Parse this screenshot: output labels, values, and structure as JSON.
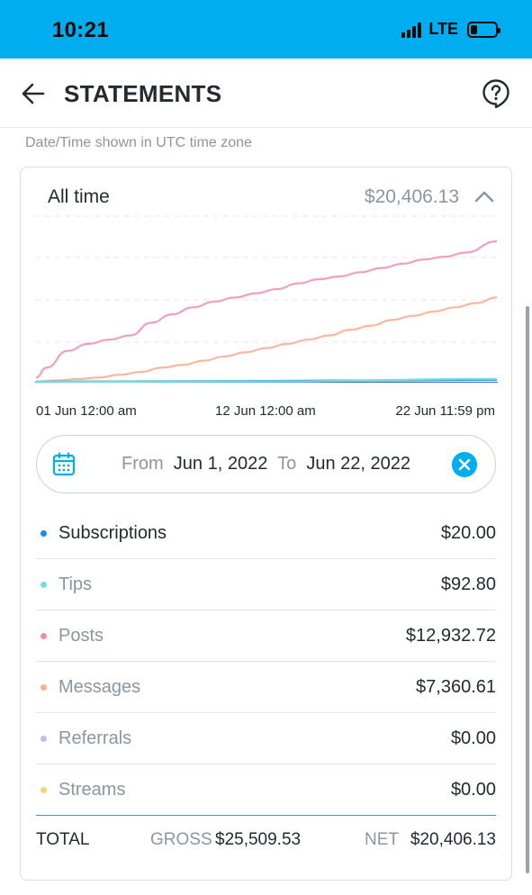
{
  "status_bar": {
    "time": "10:21",
    "network": "LTE",
    "battery_level": 0.25
  },
  "header": {
    "title": "STATEMENTS",
    "back_icon": "arrow-left-icon",
    "help_icon": "help-bubble-icon"
  },
  "timezone_note": "Date/Time shown in UTC time zone",
  "summary": {
    "period_label": "All time",
    "period_total": "$20,406.13",
    "collapse_icon": "chevron-up-icon"
  },
  "chart_data": {
    "type": "line",
    "x_tick_labels": [
      "01 Jun 12:00 am",
      "12 Jun 12:00 am",
      "22 Jun 11:59 pm"
    ],
    "x_range_days": [
      0,
      22
    ],
    "grid": true,
    "series": [
      {
        "name": "Posts",
        "color": "#f0a0b8",
        "x": [
          0,
          0.5,
          1.5,
          2.5,
          3.5,
          4.5,
          5.5,
          6.5,
          7.5,
          8.5,
          9.5,
          10.5,
          11.5,
          12.5,
          13.5,
          14.5,
          15.5,
          16.5,
          17.5,
          18.5,
          19.5,
          20.5,
          22
        ],
        "y": [
          0.03,
          0.1,
          0.22,
          0.27,
          0.3,
          0.33,
          0.42,
          0.48,
          0.53,
          0.57,
          0.6,
          0.63,
          0.66,
          0.7,
          0.73,
          0.75,
          0.78,
          0.81,
          0.84,
          0.87,
          0.89,
          0.92,
          1.0
        ]
      },
      {
        "name": "Messages",
        "color": "#f8b8a0",
        "x": [
          0,
          1,
          2,
          3,
          4,
          5,
          6,
          7,
          8,
          9,
          10,
          11,
          12,
          13,
          14,
          15,
          16,
          17,
          18,
          19,
          20,
          21,
          22
        ],
        "y": [
          0.0,
          0.01,
          0.02,
          0.03,
          0.05,
          0.07,
          0.1,
          0.12,
          0.15,
          0.18,
          0.21,
          0.24,
          0.27,
          0.3,
          0.33,
          0.37,
          0.4,
          0.44,
          0.47,
          0.5,
          0.53,
          0.56,
          0.6
        ]
      },
      {
        "name": "Subscriptions",
        "color": "#1e88e5",
        "x": [
          0,
          11,
          22
        ],
        "y": [
          0.0,
          0.005,
          0.015
        ]
      },
      {
        "name": "Tips",
        "color": "#7fd8d8",
        "x": [
          0,
          11,
          22
        ],
        "y": [
          0.0,
          0.003,
          0.02
        ]
      }
    ]
  },
  "date_range": {
    "from_label": "From",
    "from_value": "Jun 1, 2022",
    "to_label": "To",
    "to_value": "Jun 22, 2022",
    "calendar_icon": "calendar-icon",
    "clear_icon": "close-circle-icon"
  },
  "categories": [
    {
      "label": "Subscriptions",
      "value": "$20.00",
      "color": "#1e88e5",
      "active": true
    },
    {
      "label": "Tips",
      "value": "$92.80",
      "color": "#7fd8d8",
      "active": false
    },
    {
      "label": "Posts",
      "value": "$12,932.72",
      "color": "#f08cb0",
      "active": false
    },
    {
      "label": "Messages",
      "value": "$7,360.61",
      "color": "#f8b09a",
      "active": false
    },
    {
      "label": "Referrals",
      "value": "$0.00",
      "color": "#c7bde8",
      "active": false
    },
    {
      "label": "Streams",
      "value": "$0.00",
      "color": "#f5d37a",
      "active": false
    }
  ],
  "totals": {
    "label": "TOTAL",
    "gross_label": "GROSS",
    "gross_value": "$25,509.53",
    "net_label": "NET",
    "net_value": "$20,406.13"
  }
}
